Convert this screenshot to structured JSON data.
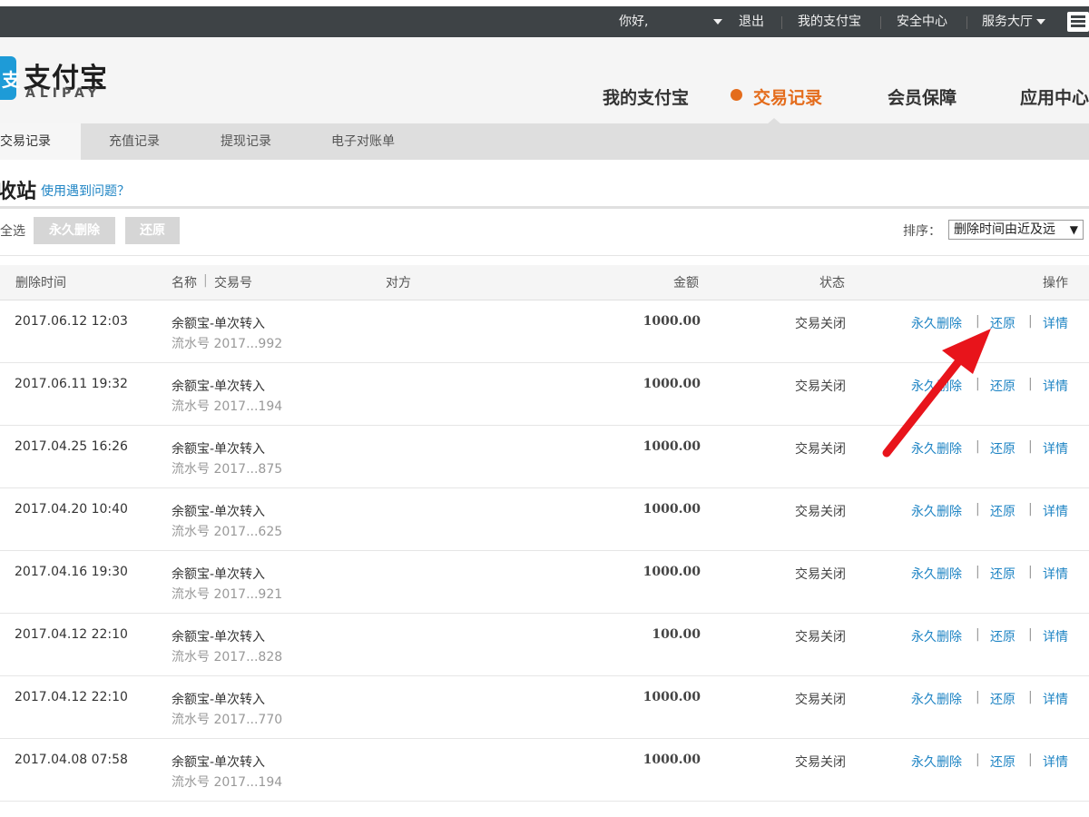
{
  "topbar": {
    "greeting": "你好,",
    "logout": "退出",
    "my_alipay": "我的支付宝",
    "security_center": "安全中心",
    "service_hall": "服务大厅"
  },
  "logo": {
    "cn": "支付宝",
    "en": "ALIPAY"
  },
  "main_nav": {
    "items": [
      "我的支付宝",
      "交易记录",
      "会员保障",
      "应用中心"
    ],
    "active": "交易记录",
    "accent_color": "#e46c1c"
  },
  "sub_tabs": {
    "items": [
      "交易记录",
      "充值记录",
      "提现记录",
      "电子对账单"
    ],
    "active": "交易记录"
  },
  "page": {
    "title": "收站",
    "help_link": "使用遇到问题？"
  },
  "toolbar": {
    "select_all": "全选",
    "delete_forever": "永久删除",
    "restore": "还原",
    "sort_label": "排序：",
    "sort_value": "删除时间由近及远"
  },
  "table": {
    "headers": {
      "time": "删除时间",
      "name": "名称",
      "divider": "|",
      "trade_no": "交易号",
      "party": "对方",
      "amount": "金额",
      "status": "状态",
      "ops": "操作"
    },
    "action_labels": {
      "delete": "永久删除",
      "restore": "还原",
      "detail": "详情",
      "sep": "|"
    },
    "rows": [
      {
        "time": "2017.06.12 12:03",
        "name": "余额宝-单次转入",
        "serial": "流水号 2017...992",
        "amount": "1000.00",
        "status": "交易关闭"
      },
      {
        "time": "2017.06.11 19:32",
        "name": "余额宝-单次转入",
        "serial": "流水号 2017...194",
        "amount": "1000.00",
        "status": "交易关闭"
      },
      {
        "time": "2017.04.25 16:26",
        "name": "余额宝-单次转入",
        "serial": "流水号 2017...875",
        "amount": "1000.00",
        "status": "交易关闭"
      },
      {
        "time": "2017.04.20 10:40",
        "name": "余额宝-单次转入",
        "serial": "流水号 2017...625",
        "amount": "1000.00",
        "status": "交易关闭"
      },
      {
        "time": "2017.04.16 19:30",
        "name": "余额宝-单次转入",
        "serial": "流水号 2017...921",
        "amount": "1000.00",
        "status": "交易关闭"
      },
      {
        "time": "2017.04.12 22:10",
        "name": "余额宝-单次转入",
        "serial": "流水号 2017...828",
        "amount": "100.00",
        "status": "交易关闭"
      },
      {
        "time": "2017.04.12 22:10",
        "name": "余额宝-单次转入",
        "serial": "流水号 2017...770",
        "amount": "1000.00",
        "status": "交易关闭"
      },
      {
        "time": "2017.04.08 07:58",
        "name": "余额宝-单次转入",
        "serial": "流水号 2017...194",
        "amount": "1000.00",
        "status": "交易关闭"
      }
    ]
  },
  "colors": {
    "link": "#1e84c4",
    "annotation_arrow": "#e8141b",
    "topbar": "#3e4346"
  }
}
